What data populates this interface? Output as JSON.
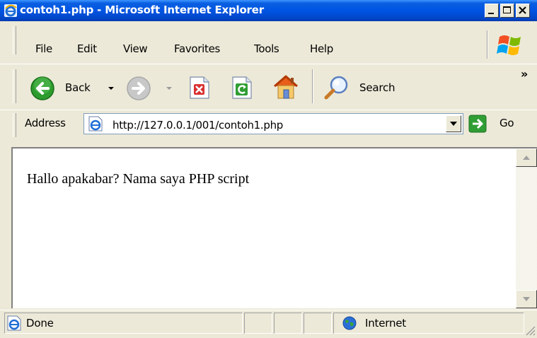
{
  "window": {
    "title": "contoh1.php - Microsoft Internet Explorer"
  },
  "menu": {
    "items": [
      "File",
      "Edit",
      "View",
      "Favorites",
      "Tools",
      "Help"
    ]
  },
  "toolbar": {
    "back_label": "Back",
    "search_label": "Search",
    "chevron": "»"
  },
  "address": {
    "label": "Address",
    "url": "http://127.0.0.1/001/contoh1.php",
    "go_label": "Go"
  },
  "content": {
    "text": "Hallo apakabar? Nama saya PHP script"
  },
  "status": {
    "text": "Done",
    "zone": "Internet"
  },
  "colors": {
    "titlebar": "#0054e3",
    "chrome": "#ece9d8",
    "back_green": "#2d9b2d",
    "go_green": "#2f9e34"
  }
}
